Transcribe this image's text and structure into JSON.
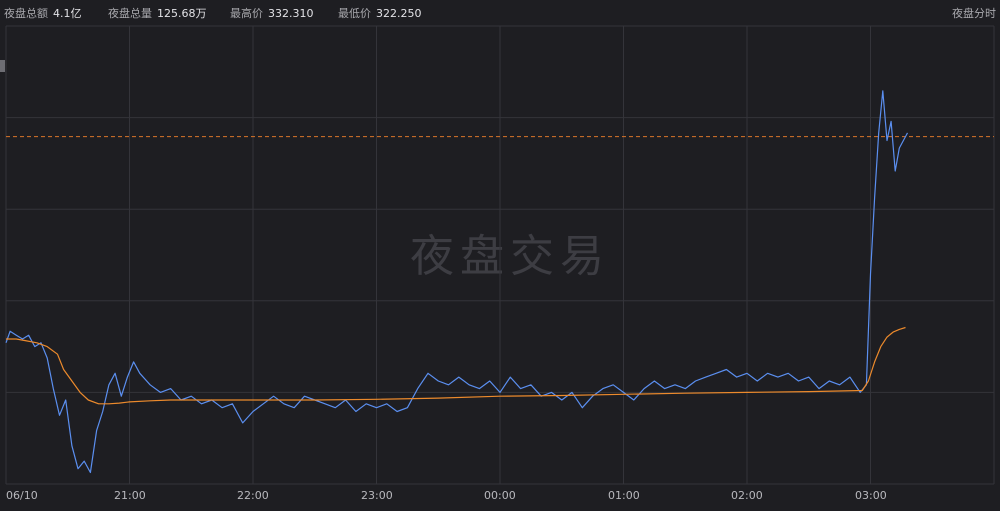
{
  "header": {
    "stats": [
      {
        "label": "夜盘总额",
        "value": "4.1亿"
      },
      {
        "label": "夜盘总量",
        "value": "125.68万"
      },
      {
        "label": "最高价",
        "value": "332.310"
      },
      {
        "label": "最低价",
        "value": "322.250"
      }
    ],
    "view_title": "夜盘分时"
  },
  "watermark": "夜盘交易",
  "colors": {
    "background": "#1e1e22",
    "grid": "#34343a",
    "price_line": "#5b8ff0",
    "avg_line": "#ec8a2c",
    "ref_line": "#d9762a"
  },
  "chart_data": {
    "type": "line",
    "x_tick_labels": [
      "06/10",
      "21:00",
      "22:00",
      "23:00",
      "00:00",
      "01:00",
      "02:00",
      "03:00"
    ],
    "x_tick_minutes": [
      0,
      60,
      120,
      180,
      240,
      300,
      360,
      420
    ],
    "xlim_minutes": [
      0,
      480
    ],
    "ylim": [
      322.0,
      334.0
    ],
    "high": 332.31,
    "low": 322.25,
    "reference_line_value": 331.1,
    "grid": true,
    "series": [
      {
        "role": "price",
        "x": [
          0,
          2,
          5,
          8,
          11,
          14,
          17,
          20,
          23,
          26,
          29,
          32,
          35,
          38,
          41,
          44,
          47,
          50,
          53,
          56,
          59,
          62,
          65,
          70,
          75,
          80,
          85,
          90,
          95,
          100,
          105,
          110,
          115,
          120,
          125,
          130,
          135,
          140,
          145,
          150,
          155,
          160,
          165,
          170,
          175,
          180,
          185,
          190,
          195,
          200,
          205,
          210,
          215,
          220,
          225,
          230,
          235,
          240,
          245,
          250,
          255,
          260,
          265,
          270,
          275,
          280,
          285,
          290,
          295,
          300,
          305,
          310,
          315,
          320,
          325,
          330,
          335,
          340,
          345,
          350,
          355,
          360,
          365,
          370,
          375,
          380,
          385,
          390,
          395,
          400,
          405,
          410,
          415,
          418,
          420,
          422,
          424,
          426,
          428,
          430,
          432,
          434,
          436,
          438
        ],
        "values": [
          325.7,
          326.0,
          325.9,
          325.8,
          325.9,
          325.6,
          325.7,
          325.3,
          324.5,
          323.8,
          324.2,
          323.0,
          322.4,
          322.6,
          322.3,
          323.4,
          323.9,
          324.6,
          324.9,
          324.3,
          324.8,
          325.2,
          324.9,
          324.6,
          324.4,
          324.5,
          324.2,
          324.3,
          324.1,
          324.2,
          324.0,
          324.1,
          323.6,
          323.9,
          324.1,
          324.3,
          324.1,
          324.0,
          324.3,
          324.2,
          324.1,
          324.0,
          324.2,
          323.9,
          324.1,
          324.0,
          324.1,
          323.9,
          324.0,
          324.5,
          324.9,
          324.7,
          324.6,
          324.8,
          324.6,
          324.5,
          324.7,
          324.4,
          324.8,
          324.5,
          324.6,
          324.3,
          324.4,
          324.2,
          324.4,
          324.0,
          324.3,
          324.5,
          324.6,
          324.4,
          324.2,
          324.5,
          324.7,
          324.5,
          324.6,
          324.5,
          324.7,
          324.8,
          324.9,
          325.0,
          324.8,
          324.9,
          324.7,
          324.9,
          324.8,
          324.9,
          324.7,
          324.8,
          324.5,
          324.7,
          324.6,
          324.8,
          324.4,
          324.6,
          327.5,
          329.5,
          331.2,
          332.3,
          331.0,
          331.5,
          330.2,
          330.8,
          331.0,
          331.2
        ]
      },
      {
        "role": "average",
        "x": [
          0,
          5,
          10,
          15,
          20,
          25,
          28,
          32,
          36,
          40,
          45,
          50,
          55,
          60,
          70,
          80,
          90,
          100,
          110,
          120,
          150,
          180,
          210,
          240,
          270,
          300,
          330,
          360,
          390,
          416,
          419,
          422,
          425,
          428,
          431,
          434,
          437
        ],
        "values": [
          325.8,
          325.8,
          325.75,
          325.7,
          325.6,
          325.4,
          325.0,
          324.7,
          324.4,
          324.2,
          324.1,
          324.1,
          324.12,
          324.15,
          324.18,
          324.2,
          324.2,
          324.2,
          324.2,
          324.2,
          324.2,
          324.22,
          324.25,
          324.3,
          324.32,
          324.35,
          324.38,
          324.4,
          324.42,
          324.45,
          324.7,
          325.2,
          325.6,
          325.85,
          325.98,
          326.05,
          326.1
        ]
      }
    ]
  }
}
